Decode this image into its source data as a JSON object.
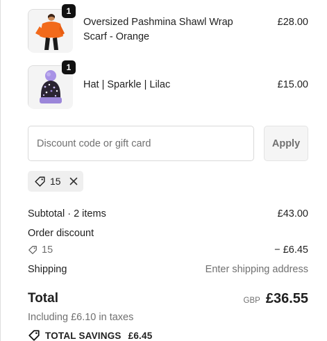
{
  "cart": {
    "items": [
      {
        "title": "Oversized Pashmina Shawl Wrap Scarf - Orange",
        "price": "£28.00",
        "quantity": "1"
      },
      {
        "title": "Hat | Sparkle | Lilac",
        "price": "£15.00",
        "quantity": "1"
      }
    ]
  },
  "discount": {
    "placeholder": "Discount code or gift card",
    "value": "",
    "apply_label": "Apply",
    "applied_code": "15"
  },
  "summary": {
    "subtotal_label": "Subtotal · 2 items",
    "subtotal_value": "£43.00",
    "order_discount_label": "Order discount",
    "discount_code": "15",
    "discount_value": "− £6.45",
    "shipping_label": "Shipping",
    "shipping_value": "Enter shipping address",
    "total_label": "Total",
    "currency": "GBP",
    "total_value": "£36.55",
    "taxes_note": "Including £6.10 in taxes",
    "savings_label": "TOTAL SAVINGS",
    "savings_value": "£6.45"
  },
  "icons": {
    "tag": "tag-icon",
    "close": "close-icon"
  },
  "colors": {
    "text": "#1f1f1f",
    "muted": "#707070",
    "border": "#d9d9d9",
    "chip_bg": "#efefef",
    "badge_bg": "#111111",
    "scarf_orange": "#f26a1b",
    "hat_lilac": "#9b86d9"
  }
}
